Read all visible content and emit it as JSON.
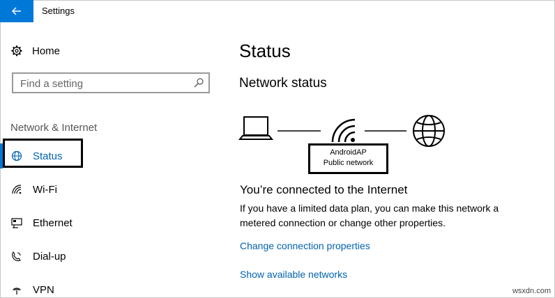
{
  "window": {
    "title": "Settings"
  },
  "sidebar": {
    "home_label": "Home",
    "search_placeholder": "Find a setting",
    "section_title": "Network & Internet",
    "items": [
      {
        "label": "Status",
        "icon": "globe-icon",
        "active": true
      },
      {
        "label": "Wi-Fi",
        "icon": "wifi-icon"
      },
      {
        "label": "Ethernet",
        "icon": "ethernet-icon"
      },
      {
        "label": "Dial-up",
        "icon": "dialup-icon"
      },
      {
        "label": "VPN",
        "icon": "vpn-icon"
      }
    ]
  },
  "main": {
    "page_title": "Status",
    "section_title": "Network status",
    "network_name": "AndroidAP",
    "network_type": "Public network",
    "connected_title": "You’re connected to the Internet",
    "description": "If you have a limited data plan, you can make this network a metered connection or change other properties.",
    "links": {
      "change_connection": "Change connection properties",
      "show_networks": "Show available networks"
    }
  },
  "watermark": "wsxdn.com",
  "colors": {
    "accent": "#0078d7",
    "link": "#0063b1"
  }
}
